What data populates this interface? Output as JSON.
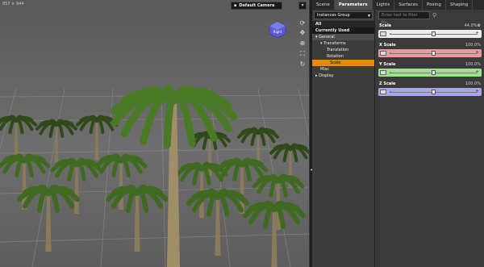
{
  "viewport": {
    "resolution": "857 × 944",
    "camera_label": "Default Camera",
    "navcube_label": "Right",
    "menu_icon": "dropdown-icon",
    "nav_tools": [
      "rotate-icon",
      "pan-icon",
      "zoom-icon",
      "frame-icon",
      "home-icon"
    ]
  },
  "tabs": [
    {
      "label": "Scene",
      "active": false
    },
    {
      "label": "Parameters",
      "active": true
    },
    {
      "label": "Lights",
      "active": false
    },
    {
      "label": "Surfaces",
      "active": false
    },
    {
      "label": "Posing",
      "active": false
    },
    {
      "label": "Shaping",
      "active": false
    }
  ],
  "tree": {
    "group_select": "Instances Group",
    "items": [
      {
        "label": "All",
        "style": "hdr"
      },
      {
        "label": "Currently Used",
        "style": "sel-hdr"
      },
      {
        "label": "▾ General",
        "style": "cat"
      },
      {
        "label": "▾ Transforms",
        "style": "indent1"
      },
      {
        "label": "Translation",
        "style": "indent2"
      },
      {
        "label": "Rotation",
        "style": "indent2"
      },
      {
        "label": "Scale",
        "style": "active"
      },
      {
        "label": "Misc",
        "style": "indent1"
      },
      {
        "label": "▸ Display",
        "style": "plain"
      }
    ]
  },
  "properties": {
    "filter_placeholder": "Enter text to filter by...",
    "items": [
      {
        "label": "Scale",
        "value": "44.0%",
        "color": "#ececec",
        "knob": 0.5
      },
      {
        "label": "X Scale",
        "value": "100.0%",
        "color": "#e89a9e",
        "knob": 0.5
      },
      {
        "label": "Y Scale",
        "value": "100.0%",
        "color": "#9ee08f",
        "knob": 0.5
      },
      {
        "label": "Z Scale",
        "value": "100.0%",
        "color": "#a8a6e8",
        "knob": 0.5
      }
    ]
  }
}
